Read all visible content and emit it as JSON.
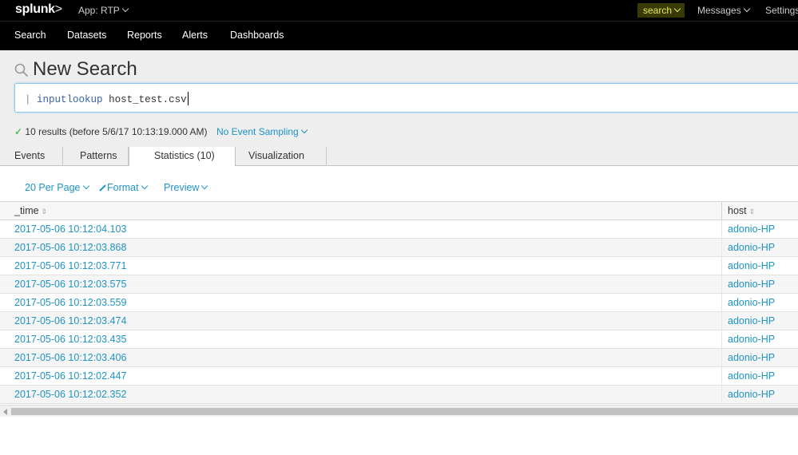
{
  "topbar": {
    "logo": "splunk",
    "logo_suffix": ">",
    "app_menu": "App: RTP",
    "user_menu": "search",
    "messages_menu": "Messages",
    "settings_menu": "Settings"
  },
  "nav": {
    "items": [
      {
        "label": "Search"
      },
      {
        "label": "Datasets"
      },
      {
        "label": "Reports"
      },
      {
        "label": "Alerts"
      },
      {
        "label": "Dashboards"
      }
    ]
  },
  "search": {
    "title": "New Search",
    "title_icon": "search-icon",
    "query_pipe": "|",
    "query_command": "inputlookup",
    "query_args": "host_test.csv",
    "status_check": "✓",
    "status_text": "10 results (before 5/6/17 10:13:19.000 AM)",
    "sampling_label": "No Event Sampling"
  },
  "tabs": [
    {
      "label": "Events",
      "active": false
    },
    {
      "label": "Patterns",
      "active": false
    },
    {
      "label": "Statistics (10)",
      "active": true
    },
    {
      "label": "Visualization",
      "active": false
    }
  ],
  "toolbar": {
    "per_page": "20 Per Page",
    "format": "Format",
    "preview": "Preview"
  },
  "table": {
    "columns": [
      "_time",
      "host"
    ],
    "sort_icon": "sort-icon",
    "rows": [
      {
        "time": "2017-05-06 10:12:04.103",
        "host": "adonio-HP"
      },
      {
        "time": "2017-05-06 10:12:03.868",
        "host": "adonio-HP"
      },
      {
        "time": "2017-05-06 10:12:03.771",
        "host": "adonio-HP"
      },
      {
        "time": "2017-05-06 10:12:03.575",
        "host": "adonio-HP"
      },
      {
        "time": "2017-05-06 10:12:03.559",
        "host": "adonio-HP"
      },
      {
        "time": "2017-05-06 10:12:03.474",
        "host": "adonio-HP"
      },
      {
        "time": "2017-05-06 10:12:03.435",
        "host": "adonio-HP"
      },
      {
        "time": "2017-05-06 10:12:03.406",
        "host": "adonio-HP"
      },
      {
        "time": "2017-05-06 10:12:02.447",
        "host": "adonio-HP"
      },
      {
        "time": "2017-05-06 10:12:02.352",
        "host": "adonio-HP"
      }
    ]
  },
  "colors": {
    "link": "#1e93c6",
    "topbar": "#000000",
    "search_bg": "#eeeeee",
    "user_menu_text": "#e8e84a"
  }
}
